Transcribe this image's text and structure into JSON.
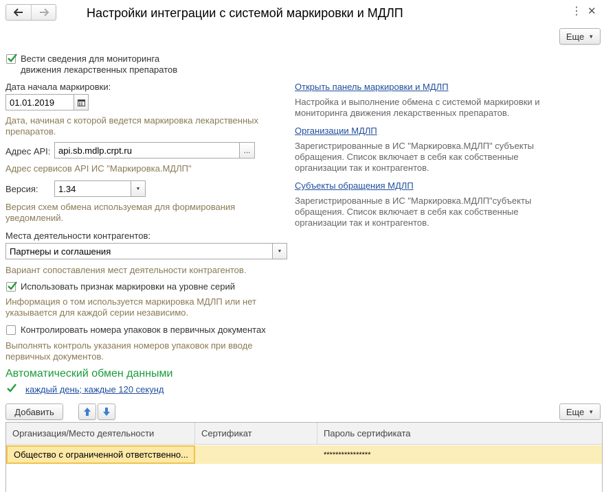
{
  "header": {
    "title": "Настройки интеграции с системой маркировки и МДЛП",
    "more_label": "Еще"
  },
  "monitoring": {
    "checked": true,
    "label_line1": "Вести сведения для мониторинга",
    "label_line2": "движения лекарственных препаратов"
  },
  "start_date": {
    "label": "Дата начала маркировки:",
    "value": "01.01.2019",
    "hint_line1": "Дата, начиная с которой ведется маркировка лекарственных",
    "hint_line2": "препаратов."
  },
  "api": {
    "label": "Адрес API:",
    "value": "api.sb.mdlp.crpt.ru",
    "button": "...",
    "hint": "Адрес сервисов API ИС \"Маркировка.МДЛП\""
  },
  "version": {
    "label": "Версия:",
    "value": "1.34",
    "hint_line1": "Версия схем обмена используемая для формирования",
    "hint_line2": "уведомлений."
  },
  "places": {
    "label": "Места деятельности контрагентов:",
    "value": "Партнеры и соглашения",
    "hint": "Вариант сопоставления мест деятельности контрагентов."
  },
  "series": {
    "checked": true,
    "label": "Использовать признак маркировки на уровне серий",
    "hint_line1": "Информация о том используется маркировка МДЛП или нет",
    "hint_line2": "указывается для каждой серии независимо."
  },
  "packages": {
    "checked": false,
    "label": "Контролировать номера упаковок в первичных документах",
    "hint_line1": "Выполнять контроль указания номеров упаковок при вводе",
    "hint_line2": "первичных документов."
  },
  "links": {
    "panel": {
      "title": "Открыть панель маркировки и МДЛП",
      "desc_line1": "Настройка и выполнение обмена с системой маркировки и",
      "desc_line2": "мониторинга движения лекарственных препаратов."
    },
    "orgs": {
      "title": "Организации МДЛП",
      "desc_line1": "Зарегистрированные в ИС \"Маркировка.МДЛП\" субъекты",
      "desc_line2": "обращения. Список включает в себя как собственные",
      "desc_line3": "организации так и контрагентов."
    },
    "subjects": {
      "title": "Субъекты обращения МДЛП",
      "desc_line1": "Зарегистрированные в ИС \"Маркировка.МДЛП\"субъекты",
      "desc_line2": "обращения. Список включает в себя как собственные",
      "desc_line3": "организации так и контрагентов."
    }
  },
  "auto_exchange": {
    "heading": "Автоматический обмен данными",
    "checked": true,
    "schedule": "каждый день; каждые 120 секунд"
  },
  "toolbar": {
    "add_label": "Добавить",
    "more_label": "Еще"
  },
  "table": {
    "columns": [
      "Организация/Место деятельности",
      "Сертификат",
      "Пароль сертификата"
    ],
    "rows": [
      {
        "org": "Общество с ограниченной ответственно...",
        "cert": "",
        "password": "****************"
      }
    ]
  },
  "colors": {
    "hint": "#8a7a55",
    "link": "#1f4e9e",
    "section_heading": "#1a9b3a",
    "selected_row": "#fbeeb8",
    "check": "#2a9a3a"
  }
}
